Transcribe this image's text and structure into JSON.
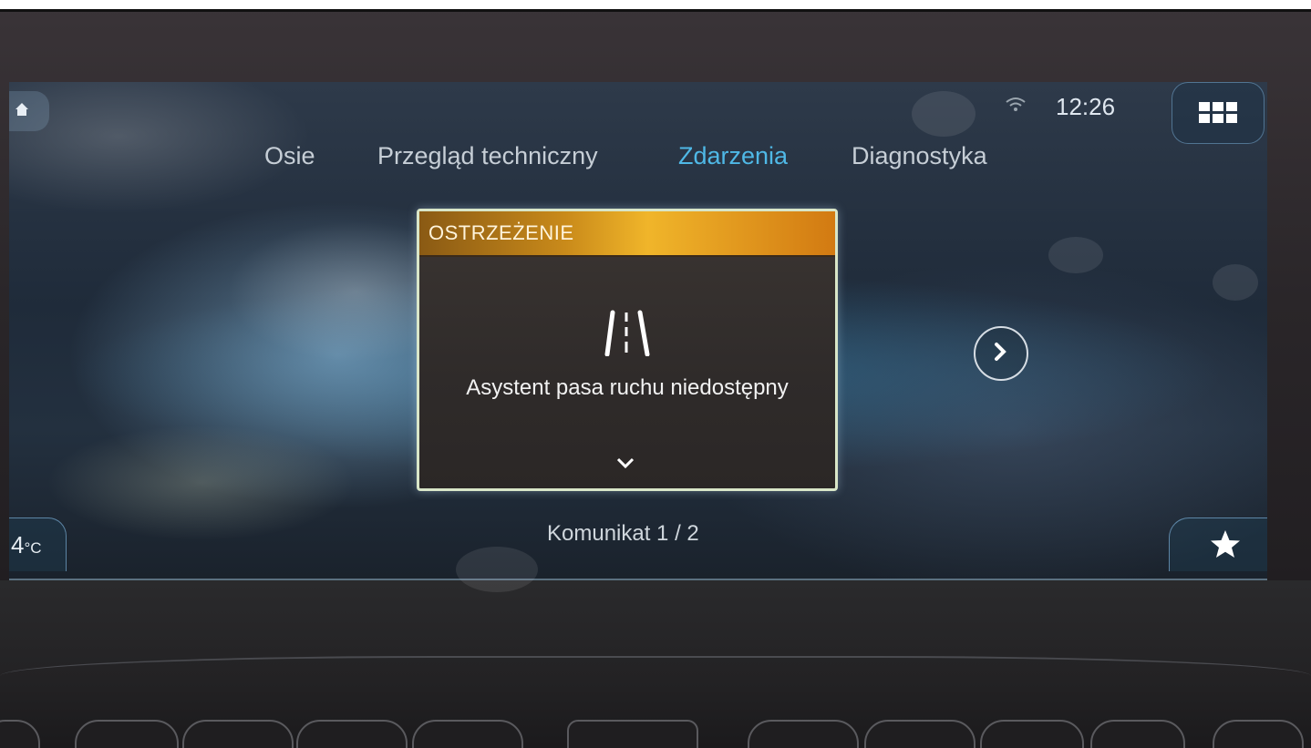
{
  "status_bar": {
    "time": "12:26",
    "wifi_icon": "wifi-icon",
    "apps_icon": "grid-icon"
  },
  "tabs": [
    {
      "label": "Osie",
      "active": false
    },
    {
      "label": "Przegląd techniczny",
      "active": false
    },
    {
      "label": "Zdarzenia",
      "active": true
    },
    {
      "label": "Diagnostyka",
      "active": false
    }
  ],
  "warning": {
    "header": "OSTRZEŻENIE",
    "icon": "lane-assist-icon",
    "message": "Asystent pasa ruchu niedostępny",
    "more_icon": "chevron-down-icon"
  },
  "navigation": {
    "next_icon": "chevron-right-icon",
    "counter": "Komunikat 1 / 2"
  },
  "climate": {
    "temperature": "4",
    "unit": "°C"
  },
  "favorites": {
    "icon": "star-icon"
  },
  "colors": {
    "active_tab": "#4fb8e6",
    "warning_header": "#f0b52a",
    "inactive_tab": "#c6ced6"
  }
}
